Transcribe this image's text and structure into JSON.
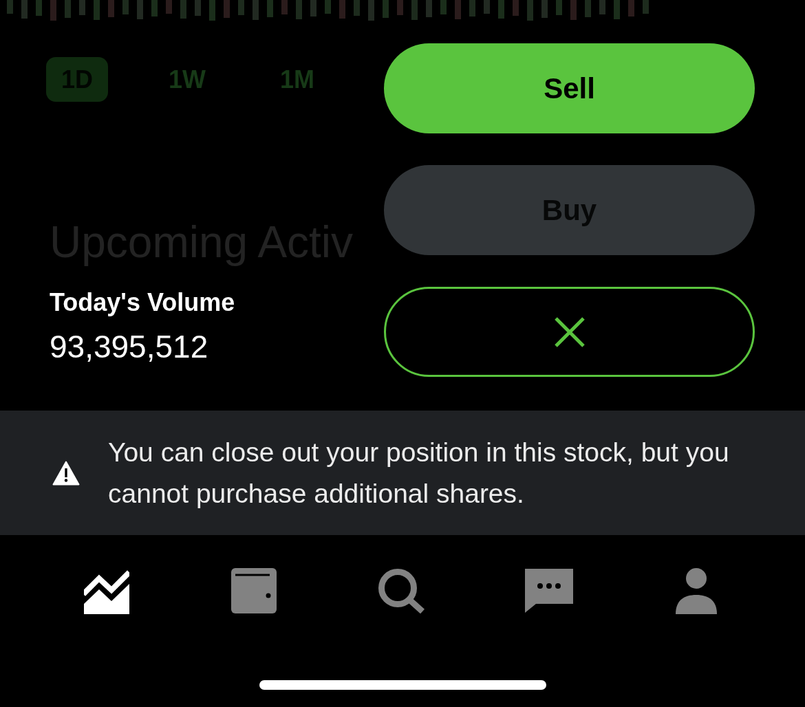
{
  "range_tabs": [
    {
      "label": "1D",
      "selected": true
    },
    {
      "label": "1W",
      "selected": false
    },
    {
      "label": "1M",
      "selected": false
    }
  ],
  "section_heading": "Upcoming Activ",
  "volume": {
    "label": "Today's Volume",
    "value": "93,395,512"
  },
  "actions": [
    {
      "kind": "sell",
      "label": "Sell",
      "disabled": false
    },
    {
      "kind": "buy",
      "label": "Buy",
      "disabled": true
    },
    {
      "kind": "close",
      "disabled": false
    }
  ],
  "notice": {
    "text": "You can close out your position in this stock, but you cannot purchase additional shares."
  },
  "tab_bar": [
    {
      "kind": "chart",
      "selected": true
    },
    {
      "kind": "wallet",
      "selected": false
    },
    {
      "kind": "search",
      "selected": false
    },
    {
      "kind": "messages",
      "selected": false
    },
    {
      "kind": "profile",
      "selected": false
    }
  ]
}
